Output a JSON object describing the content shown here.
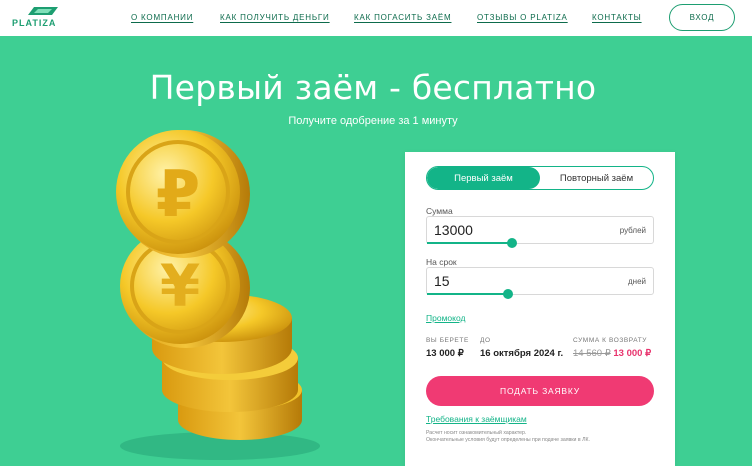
{
  "brand": {
    "name": "PLATIZA",
    "accent": "#13b488",
    "background": "#3ecf93",
    "cta": "#f03a73"
  },
  "nav": {
    "items": [
      "О КОМПАНИИ",
      "КАК ПОЛУЧИТЬ ДЕНЬГИ",
      "КАК ПОГАСИТЬ ЗАЁМ",
      "ОТЗЫВЫ О PLATIZA",
      "КОНТАКТЫ"
    ],
    "login": "ВХОД"
  },
  "hero": {
    "title": "Первый заём - бесплатно",
    "subtitle": "Получите одобрение за 1 минуту"
  },
  "calculator": {
    "tabs": [
      "Первый заём",
      "Повторный заём"
    ],
    "active_tab": 0,
    "amount": {
      "label": "Сумма",
      "value": "13000",
      "unit": "рублей",
      "slider_fraction": 0.37
    },
    "term": {
      "label": "На срок",
      "value": "15",
      "unit": "дней",
      "slider_fraction": 0.35
    },
    "promo": "Промокод",
    "summary": {
      "take_label": "ВЫ БЕРЕТЕ",
      "take_value": "13 000 ₽",
      "until_label": "ДО",
      "until_value": "16 октября 2024 г.",
      "return_label": "СУММА К ВОЗВРАТУ",
      "return_old": "14 560 ₽",
      "return_new": "13 000 ₽"
    },
    "submit": "ПОДАТЬ ЗАЯВКУ",
    "requirements": "Требования к заёмщикам",
    "disclaimer_1": "Расчет носит ознакомительный характер.",
    "disclaimer_2": "Окончательные условия будут определены при подаче заявки в ЛК."
  }
}
